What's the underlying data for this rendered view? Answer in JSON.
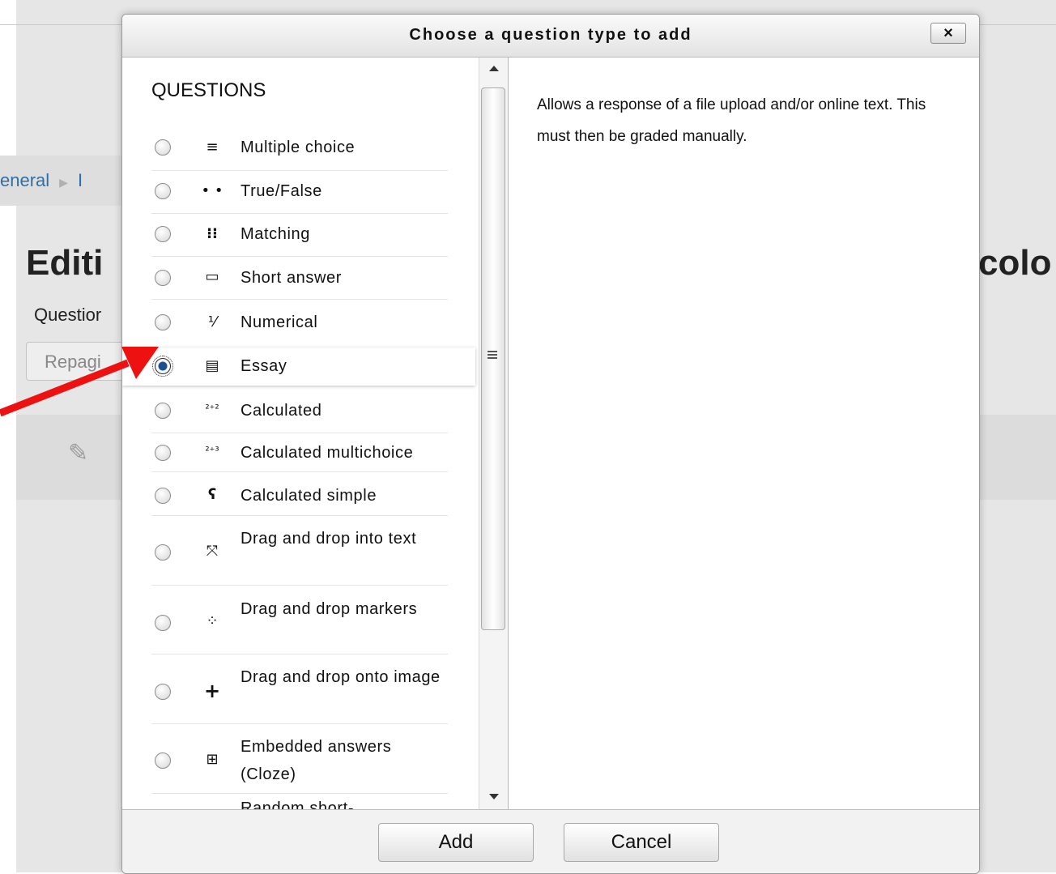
{
  "background": {
    "breadcrumb": {
      "first": "eneral",
      "separator": "▶",
      "next": "I"
    },
    "heading_left": "Editi",
    "heading_right": "colo",
    "questions_label": "Questior",
    "repaginate_label": "Repagi"
  },
  "dialog": {
    "title": "Choose a question type to add",
    "close_label": "×",
    "section_title": "QUESTIONS",
    "selected": "Essay",
    "options": [
      {
        "label": "Multiple choice",
        "icon": "≡"
      },
      {
        "label": "True/False",
        "icon": "• •"
      },
      {
        "label": "Matching",
        "icon": "⁝⁝"
      },
      {
        "label": "Short answer",
        "icon": "▭"
      },
      {
        "label": "Numerical",
        "icon": "⅟"
      },
      {
        "label": "Essay",
        "icon": "▤"
      },
      {
        "label": "Calculated",
        "icon": "²⁺²"
      },
      {
        "label": "Calculated multichoice",
        "icon": "²⁺³"
      },
      {
        "label": "Calculated simple",
        "icon": "ʕ"
      },
      {
        "label": "Drag and drop into text",
        "icon": "⤧"
      },
      {
        "label": "Drag and drop markers",
        "icon": "⁘"
      },
      {
        "label": "Drag and drop onto image",
        "icon": "+"
      },
      {
        "label": "Embedded answers (Cloze)",
        "icon": "⊞"
      },
      {
        "label": "Random short-",
        "icon": "• •"
      }
    ],
    "description": "Allows a response of a file upload and/or online text. This must then be graded manually.",
    "add_label": "Add",
    "cancel_label": "Cancel"
  },
  "colors": {
    "arrow": "#ee1111",
    "link": "#2f6fa8",
    "radio_selected": "#1b4f8f"
  }
}
